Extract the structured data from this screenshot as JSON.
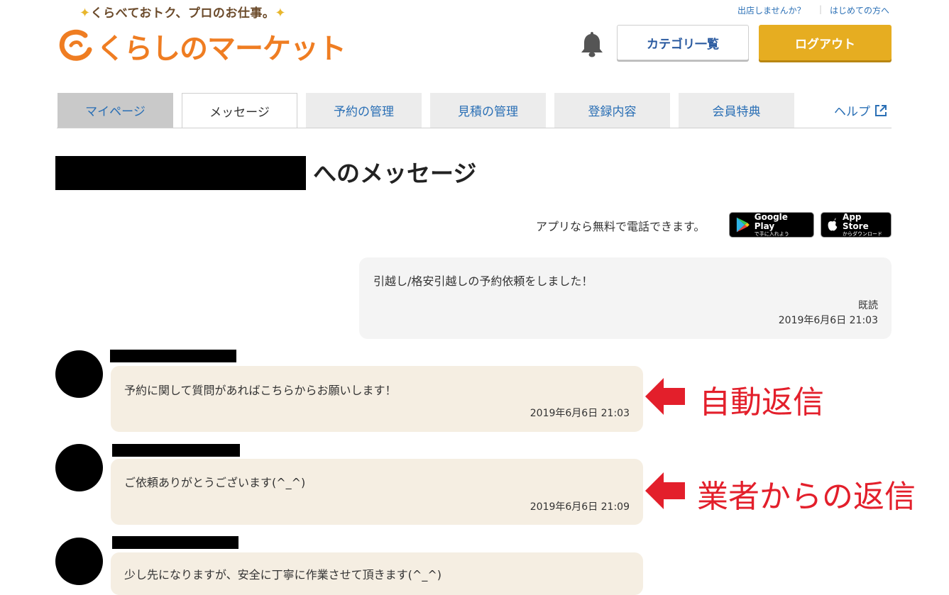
{
  "header": {
    "tagline": "くらべておトク、プロのお仕事。",
    "logo_text": "くらしのマーケット",
    "link_seller": "出店しませんか？",
    "link_first": "はじめての方へ",
    "category_button": "カテゴリ一覧",
    "logout_button": "ログアウト"
  },
  "tabs": [
    {
      "label": "マイページ"
    },
    {
      "label": "メッセージ"
    },
    {
      "label": "予約の管理"
    },
    {
      "label": "見積の管理"
    },
    {
      "label": "登録内容"
    },
    {
      "label": "会員特典"
    }
  ],
  "help_label": "ヘルプ",
  "page_title": "へのメッセージ",
  "app_promo": {
    "text": "アプリなら無料で電話できます。",
    "google_main": "Google Play",
    "google_sub": "で手に入れよう",
    "apple_main": "App Store",
    "apple_sub": "からダウンロード"
  },
  "messages": [
    {
      "text": "引越し/格安引越しの予約依頼をしました！",
      "read": "既読",
      "time": "2019年6月6日 21:03"
    },
    {
      "text": "予約に関して質問があればこちらからお願いします！",
      "time": "2019年6月6日 21:03"
    },
    {
      "text": "ご依頼ありがとうございます(^_^)",
      "time": "2019年6月6日 21:09"
    },
    {
      "text": "少し先になりますが、安全に丁寧に作業させて頂きます(^_^)"
    }
  ],
  "annotations": {
    "auto_reply": "自動返信",
    "vendor_reply": "業者からの返信"
  },
  "colors": {
    "accent_orange": "#ef7d22",
    "logout_gold": "#e6ad21",
    "link_blue": "#2a6fb5",
    "annotation_red": "#e31f2b",
    "vendor_bubble": "#f5eee2"
  }
}
